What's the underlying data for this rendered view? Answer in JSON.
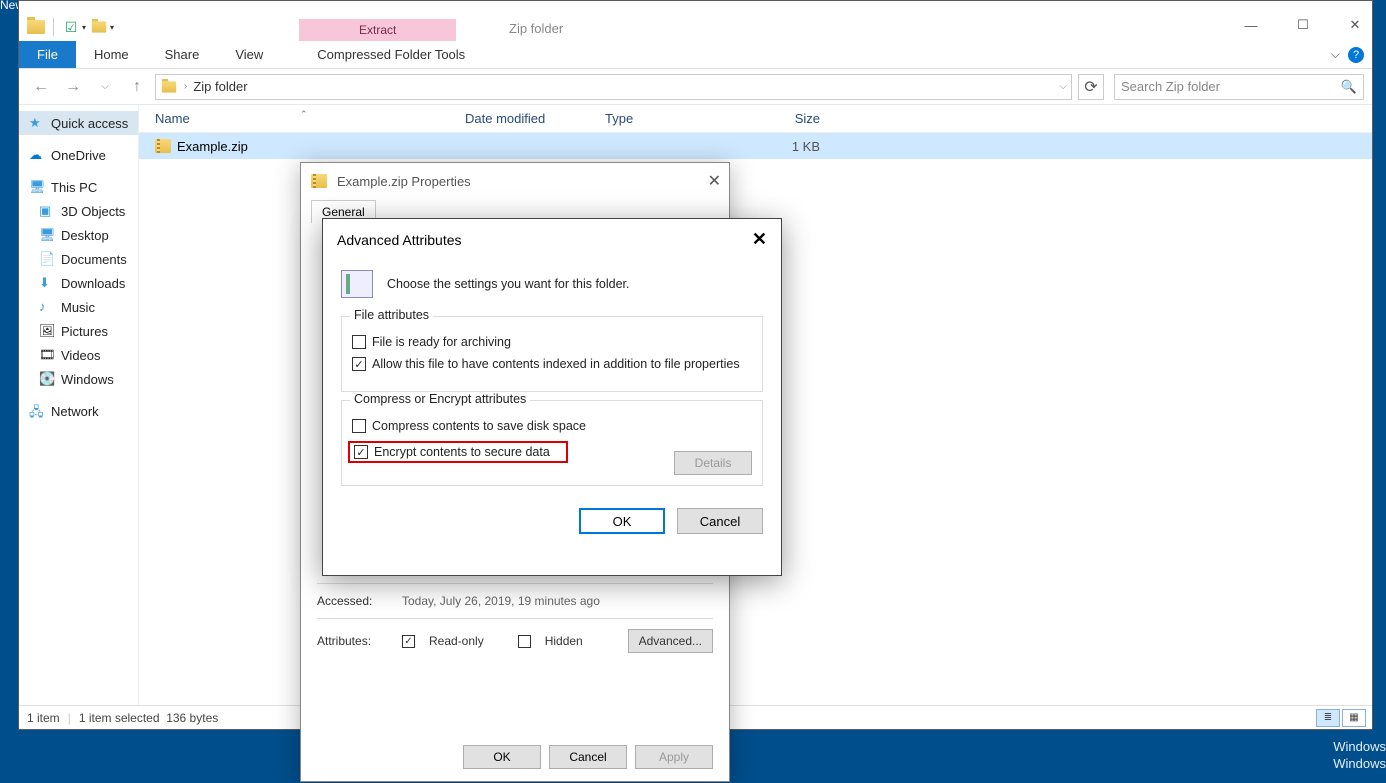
{
  "desktop_label": "New folder",
  "window": {
    "title": "Zip folder",
    "contextual_label": "Extract",
    "contextual_group": "Compressed Folder Tools",
    "tabs": {
      "file": "File",
      "home": "Home",
      "share": "Share",
      "view": "View"
    },
    "min": "—",
    "max": "☐",
    "close": "✕",
    "chevron": "⌵"
  },
  "nav": {
    "back": "←",
    "fwd": "→",
    "up": "↑",
    "crumb": "Zip folder",
    "refresh": "⟳",
    "search_placeholder": "Search Zip folder"
  },
  "navpane": {
    "quick": "Quick access",
    "onedrive": "OneDrive",
    "thispc": "This PC",
    "items": [
      "3D Objects",
      "Desktop",
      "Documents",
      "Downloads",
      "Music",
      "Pictures",
      "Videos",
      "Windows"
    ],
    "network": "Network"
  },
  "columns": {
    "name": "Name",
    "date": "Date modified",
    "type": "Type",
    "size": "Size"
  },
  "row": {
    "name": "Example.zip",
    "date": "",
    "type": "",
    "size": "1 KB"
  },
  "status": {
    "items": "1 item",
    "selected": "1 item selected",
    "bytes": "136 bytes"
  },
  "props": {
    "title": "Example.zip Properties",
    "tab_general": "General",
    "accessed_label": "Accessed:",
    "accessed_value": "Today, July 26, 2019, 19 minutes ago",
    "attributes_label": "Attributes:",
    "readonly": "Read-only",
    "hidden": "Hidden",
    "advanced": "Advanced...",
    "ok": "OK",
    "cancel": "Cancel",
    "apply": "Apply"
  },
  "adv": {
    "title": "Advanced Attributes",
    "intro": "Choose the settings you want for this folder.",
    "group1": "File attributes",
    "ready": "File is ready for archiving",
    "index": "Allow this file to have contents indexed in addition to file properties",
    "group2": "Compress or Encrypt attributes",
    "compress": "Compress contents to save disk space",
    "encrypt": "Encrypt contents to secure data",
    "details": "Details",
    "ok": "OK",
    "cancel": "Cancel"
  },
  "watermark": {
    "l1": "Windows",
    "l2": "Windows"
  }
}
